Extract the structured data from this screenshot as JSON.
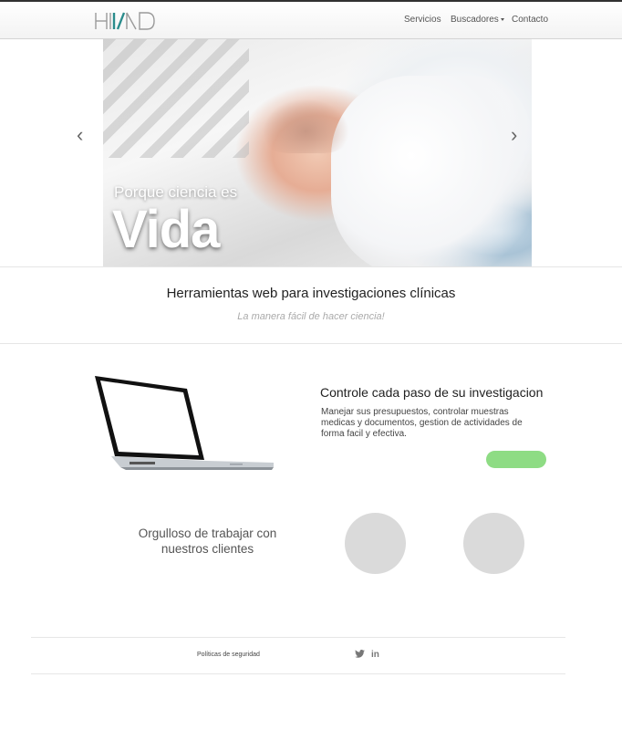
{
  "nav": {
    "logo_alt": "HMD",
    "items": [
      {
        "label": "Servicios"
      },
      {
        "label": "Buscadores"
      },
      {
        "label": "Contacto"
      }
    ]
  },
  "hero": {
    "small_text": "Porque ciencia es",
    "big_text": "Vida",
    "prev_arrow": "‹",
    "next_arrow": "›"
  },
  "intro": {
    "headline": "Herramientas web para investigaciones clínicas",
    "subline": "La manera fácil de hacer ciencia!"
  },
  "feature": {
    "title": "Controle cada paso de su investigacion",
    "description": "Manejar sus presupuestos, controlar muestras medicas y documentos, gestion de actividades de forma facil y efectiva.",
    "button_color": "#8edc84"
  },
  "clients": {
    "text": "Orgulloso de trabajar con nuestros clientes"
  },
  "footer": {
    "link": "Políticas de seguridad",
    "twitter_icon": "twitter-icon",
    "linkedin_icon": "linkedin-icon",
    "linkedin_glyph": "in"
  },
  "colors": {
    "accent_green": "#8edc84",
    "logo_teal": "#2a8c8c"
  }
}
